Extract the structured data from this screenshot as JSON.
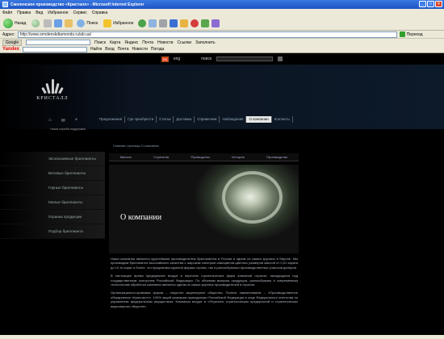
{
  "window": {
    "title": "Смоленское производство «Кристалл» - Microsoft Internet Explorer",
    "min": "_",
    "max": "□",
    "close": "×"
  },
  "menu": [
    "Файл",
    "Правка",
    "Вид",
    "Избранное",
    "Сервис",
    "Справка"
  ],
  "toolbar": {
    "back": "Назад",
    "search": "Поиск",
    "favorites": "Избранное",
    "icon_colors": [
      "#3b6fd4",
      "#e9b341",
      "#d43b3b",
      "#5aa64c",
      "#8a6bd1"
    ]
  },
  "address": {
    "label": "Адрес:",
    "url": "http://www.smolenskdiamonds.ru/ab.ua/",
    "go": "Переход"
  },
  "links": {
    "items": [
      "Google",
      "Поиск",
      "Карта",
      "Яндекс",
      "Почта",
      "Новости",
      "Ссылки",
      "Заполнить"
    ],
    "search_label": "Найти"
  },
  "yandex": {
    "logo": "Yandex",
    "items": [
      "Найти",
      "Вход",
      "Почта",
      "Новости",
      "Погода"
    ]
  },
  "site": {
    "top": {
      "lang": "EN",
      "lang_label": "eng",
      "search_label": "поиск"
    },
    "logo": {
      "name": "КРИСТАЛЛ"
    },
    "nav": [
      "Предложения",
      "Где приобрести",
      "Статьи",
      "Доставка",
      "Справочник",
      "Наблюдения",
      "О компании",
      "Контакты"
    ],
    "active_nav_index": 6,
    "util": {
      "icons": [
        "⌂",
        "✉",
        "+"
      ],
      "label": "Наша служба поддержки"
    },
    "breadcrumb": "Главная страница  О компании",
    "sidebar": [
      "Эксклюзивные бриллианты",
      "Весовые бриллианты",
      "Горные бриллианты",
      "Малые бриллианты",
      "Огранка продукции",
      "Подбор бриллианта"
    ],
    "subnav": [
      "Миссия",
      "Стратегия",
      "Руководство",
      "История",
      "Производство"
    ],
    "hero_title": "О компании",
    "paragraphs": [
      "Наша компания является крупнейшим производителем бриллиантов в России и одним из самых крупных в Европе. Мы производим бриллианты высочайшего качества с широким спектром самоцветов-цветных размеров массой от 0,01 карата до 10-ти карат и более, что предлагаем крупной фирмы страны, так и разнообразных производственных участков дилеров.",
      "В настоящее время предприятие входит в перечень стратегических фирм алмазной отрасли, находящихся под государственным контролем Российской Федерации. По объемам выпуска продукции, разнообразию и современным технологиям обработки компания является одним из самых крупных производителей в отрасли.",
      "Организационно-правовая форма – открытое акционерное общество. Полное наименование – «Производственное объединение «Кристалл»». 100% акций компании принадлежит Российской Федерации в лице Федерального агентства по управлению федеральным имуществом. Компания входит в «Перечень стратегических предприятий и стратегических акционерных обществ»."
    ]
  }
}
